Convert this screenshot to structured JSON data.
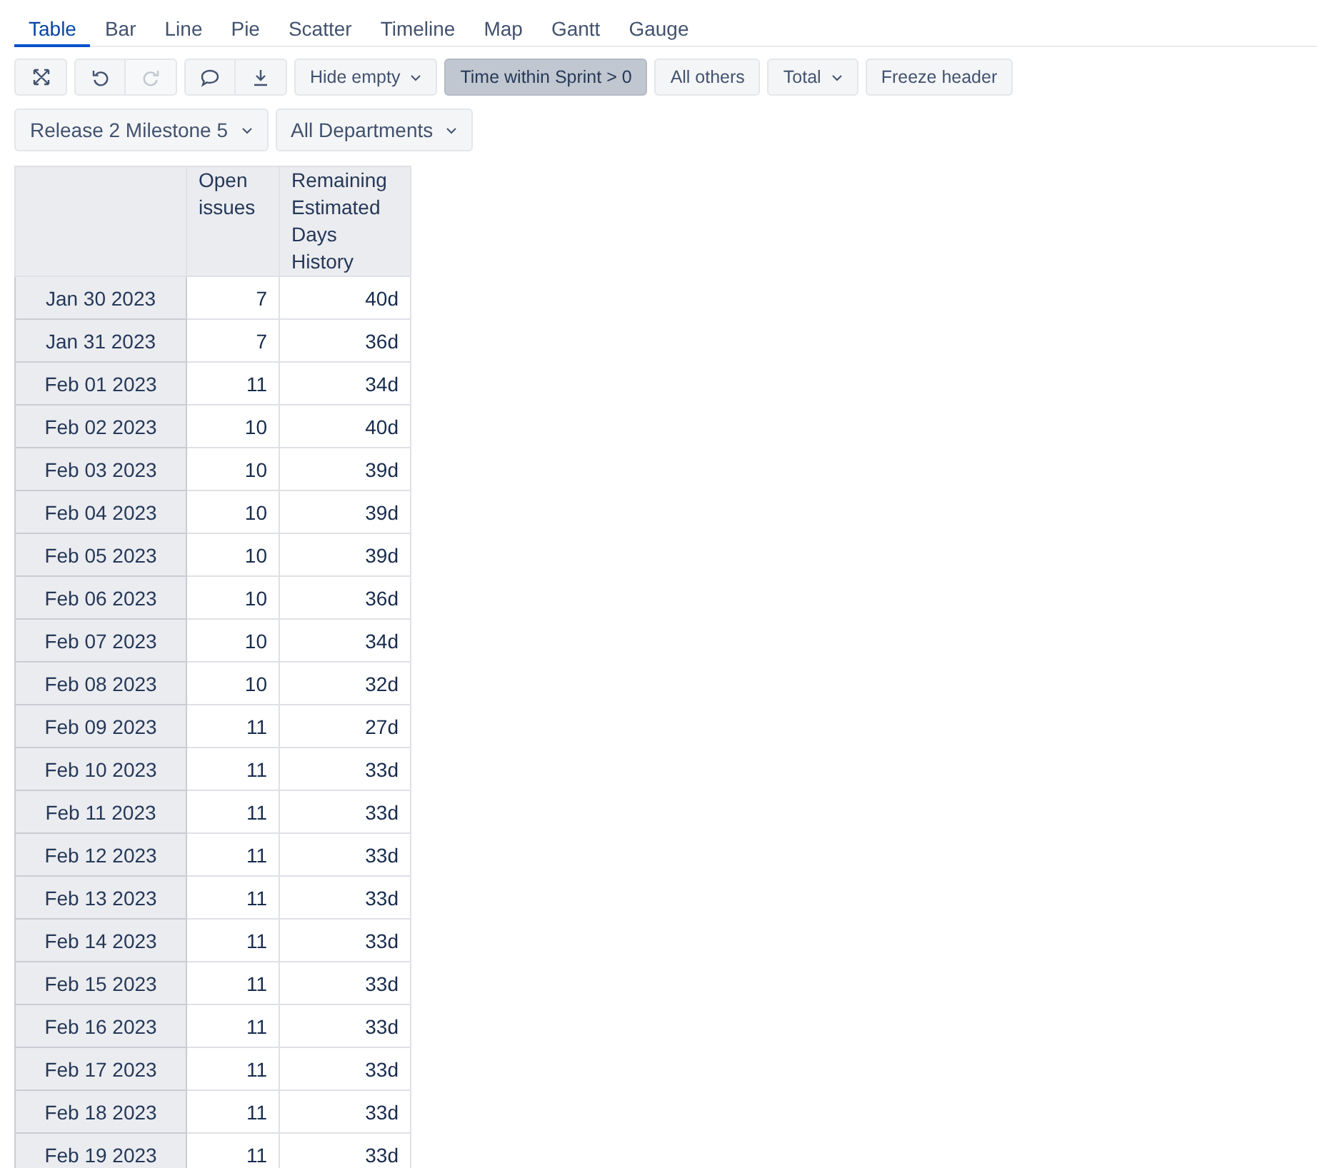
{
  "tabs": [
    {
      "label": "Table",
      "selected": true
    },
    {
      "label": "Bar",
      "selected": false
    },
    {
      "label": "Line",
      "selected": false
    },
    {
      "label": "Pie",
      "selected": false
    },
    {
      "label": "Scatter",
      "selected": false
    },
    {
      "label": "Timeline",
      "selected": false
    },
    {
      "label": "Map",
      "selected": false
    },
    {
      "label": "Gantt",
      "selected": false
    },
    {
      "label": "Gauge",
      "selected": false
    }
  ],
  "toolbar": {
    "icon_groups": [
      [
        {
          "kind": "expand",
          "disabled": false
        }
      ],
      [
        {
          "kind": "undo",
          "disabled": false
        },
        {
          "kind": "redo",
          "disabled": true
        }
      ],
      [
        {
          "kind": "comment",
          "disabled": false
        },
        {
          "kind": "download",
          "disabled": false
        }
      ]
    ],
    "buttons": [
      {
        "label": "Hide empty",
        "dropdown": true,
        "selected": false
      },
      {
        "label": "Time within Sprint > 0",
        "dropdown": false,
        "selected": true
      },
      {
        "label": "All others",
        "dropdown": false,
        "selected": false
      },
      {
        "label": "Total",
        "dropdown": true,
        "selected": false
      },
      {
        "label": "Freeze header",
        "dropdown": false,
        "selected": false
      }
    ]
  },
  "filters": [
    {
      "label": "Release 2 Milestone 5"
    },
    {
      "label": "All Departments"
    }
  ],
  "table": {
    "columns": [
      "Open issues",
      "Remaining Estimated Days History"
    ],
    "rows": [
      {
        "label": "Jan 30 2023",
        "values": [
          "7",
          "40d"
        ]
      },
      {
        "label": "Jan 31 2023",
        "values": [
          "7",
          "36d"
        ]
      },
      {
        "label": "Feb 01 2023",
        "values": [
          "11",
          "34d"
        ]
      },
      {
        "label": "Feb 02 2023",
        "values": [
          "10",
          "40d"
        ]
      },
      {
        "label": "Feb 03 2023",
        "values": [
          "10",
          "39d"
        ]
      },
      {
        "label": "Feb 04 2023",
        "values": [
          "10",
          "39d"
        ]
      },
      {
        "label": "Feb 05 2023",
        "values": [
          "10",
          "39d"
        ]
      },
      {
        "label": "Feb 06 2023",
        "values": [
          "10",
          "36d"
        ]
      },
      {
        "label": "Feb 07 2023",
        "values": [
          "10",
          "34d"
        ]
      },
      {
        "label": "Feb 08 2023",
        "values": [
          "10",
          "32d"
        ]
      },
      {
        "label": "Feb 09 2023",
        "values": [
          "11",
          "27d"
        ]
      },
      {
        "label": "Feb 10 2023",
        "values": [
          "11",
          "33d"
        ]
      },
      {
        "label": "Feb 11 2023",
        "values": [
          "11",
          "33d"
        ]
      },
      {
        "label": "Feb 12 2023",
        "values": [
          "11",
          "33d"
        ]
      },
      {
        "label": "Feb 13 2023",
        "values": [
          "11",
          "33d"
        ]
      },
      {
        "label": "Feb 14 2023",
        "values": [
          "11",
          "33d"
        ]
      },
      {
        "label": "Feb 15 2023",
        "values": [
          "11",
          "33d"
        ]
      },
      {
        "label": "Feb 16 2023",
        "values": [
          "11",
          "33d"
        ]
      },
      {
        "label": "Feb 17 2023",
        "values": [
          "11",
          "33d"
        ]
      },
      {
        "label": "Feb 18 2023",
        "values": [
          "11",
          "33d"
        ]
      },
      {
        "label": "Feb 19 2023",
        "values": [
          "11",
          "33d"
        ]
      }
    ]
  }
}
